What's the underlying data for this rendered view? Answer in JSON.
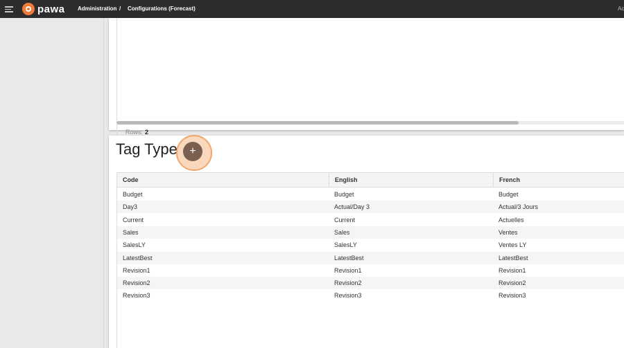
{
  "header": {
    "brand": "pawa",
    "breadcrumb": [
      "Administration",
      "/",
      "Configurations (Forecast)"
    ],
    "right_text": "Ac"
  },
  "top_grid": {
    "rows_label": "Rows:",
    "rows_count": "2"
  },
  "tag_type": {
    "title": "Tag Type",
    "add_label": "+",
    "columns": [
      "Code",
      "English",
      "French"
    ],
    "rows": [
      [
        "Budget",
        "Budget",
        "Budget"
      ],
      [
        "Day3",
        "Actual/Day 3",
        "Actual/3 Jours"
      ],
      [
        "Current",
        "Current",
        "Actuelles"
      ],
      [
        "Sales",
        "Sales",
        "Ventes"
      ],
      [
        "SalesLY",
        "SalesLY",
        "Ventes LY"
      ],
      [
        "LatestBest",
        "LatestBest",
        "LatestBest"
      ],
      [
        "Revision1",
        "Revision1",
        "Revision1"
      ],
      [
        "Revision2",
        "Revision2",
        "Revision2"
      ],
      [
        "Revision3",
        "Revision3",
        "Revision3"
      ]
    ]
  },
  "colors": {
    "topbar": "#2d2d2f",
    "brand": "#f07a38",
    "add_button": "#7a5e50",
    "add_highlight": "#f2a66a"
  }
}
